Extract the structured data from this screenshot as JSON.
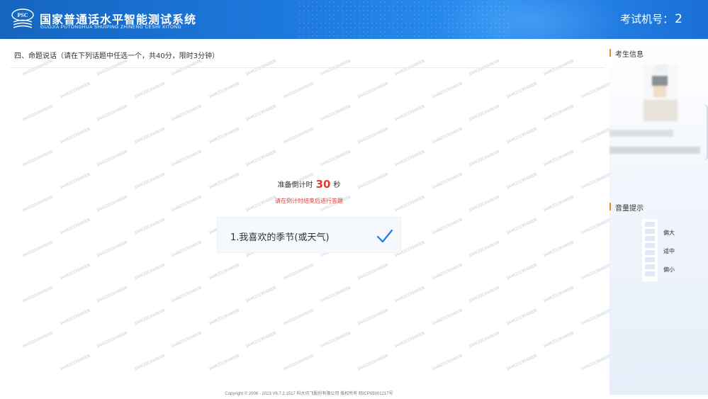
{
  "header": {
    "title": "国家普通话水平智能测试系统",
    "subtitle": "GUOJIA PUTONGHUA SHUIPING ZHINENG CESHI XITONG",
    "logo_text": "PSC",
    "exam_no_label": "考试机号：",
    "exam_no_value": "2",
    "colors": {
      "primary": "#1565c0",
      "accent": "#2a8ef0"
    }
  },
  "main": {
    "section_title": "四、命题说话（请在下列话题中任选一个，共40分，限时3分钟）",
    "countdown": {
      "label": "准备倒计时",
      "value": "30",
      "unit": "秒"
    },
    "hint": "请在倒计时结束后进行答题",
    "topic": {
      "label": "1.我喜欢的季节(或天气)",
      "icon": "check-icon",
      "selected": true
    },
    "watermark_text": "34482023048006",
    "footer": "Copyright © 2006 - 2023 V6.7.2.1517 科大讯飞股份有限公司 版权所有 皖ICP05001217号"
  },
  "sidebar": {
    "candidate_info_title": "考生信息",
    "volume_title": "音量提示",
    "volume_levels": [
      "偏大",
      "适中",
      "偏小"
    ],
    "colors": {
      "heading_marker": "#f0891a",
      "meter": "#dfe9f7"
    }
  },
  "colors": {
    "countdown_number": "#e53935",
    "check": "#1e7be0"
  }
}
